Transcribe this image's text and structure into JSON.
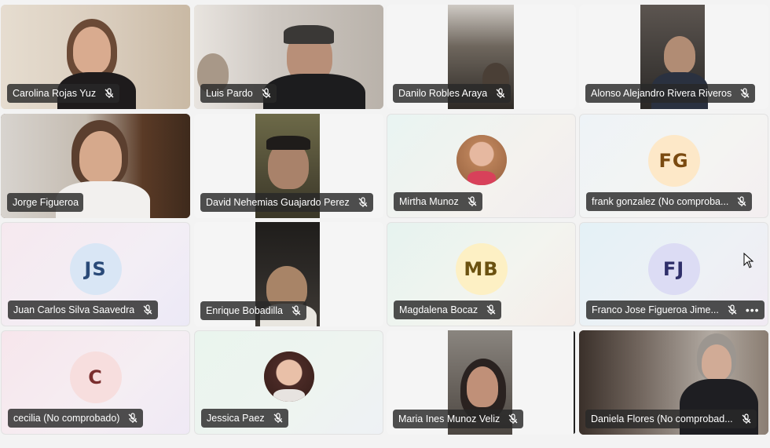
{
  "participants": [
    {
      "name": "Carolina Rojas Yuz",
      "type": "video"
    },
    {
      "name": "Luis Pardo",
      "type": "video"
    },
    {
      "name": "Danilo Robles Araya",
      "type": "narrow-video"
    },
    {
      "name": "Alonso Alejandro Rivera Riveros",
      "type": "narrow-video"
    },
    {
      "name": "Jorge Figueroa",
      "type": "video"
    },
    {
      "name": "David Nehemias Guajardo Perez",
      "type": "narrow-video"
    },
    {
      "name": "Mirtha Munoz",
      "type": "photo"
    },
    {
      "name": "frank gonzalez (No comproba...",
      "type": "initials",
      "initials": "FG",
      "bg": "#fde8c8",
      "fg": "#7a4a10"
    },
    {
      "name": "Juan Carlos Silva Saavedra",
      "type": "initials",
      "initials": "JS",
      "bg": "#d9e6f5",
      "fg": "#2a4a78"
    },
    {
      "name": "Enrique Bobadilla",
      "type": "narrow-video"
    },
    {
      "name": "Magdalena Bocaz",
      "type": "initials",
      "initials": "MB",
      "bg": "#fdf0c4",
      "fg": "#6b5210"
    },
    {
      "name": "Franco Jose Figueroa Jime...",
      "type": "initials",
      "initials": "FJ",
      "bg": "#dcdcf4",
      "fg": "#2f2f6a",
      "more": "•••"
    },
    {
      "name": "cecilia (No comprobado)",
      "type": "initials",
      "initials": "C",
      "bg": "#f7dede",
      "fg": "#7a2e2e"
    },
    {
      "name": "Jessica Paez",
      "type": "photo"
    },
    {
      "name": "Maria Ines Munoz Veliz",
      "type": "narrow-video"
    },
    {
      "name": "Daniela Flores (No comprobad...",
      "type": "video"
    }
  ]
}
